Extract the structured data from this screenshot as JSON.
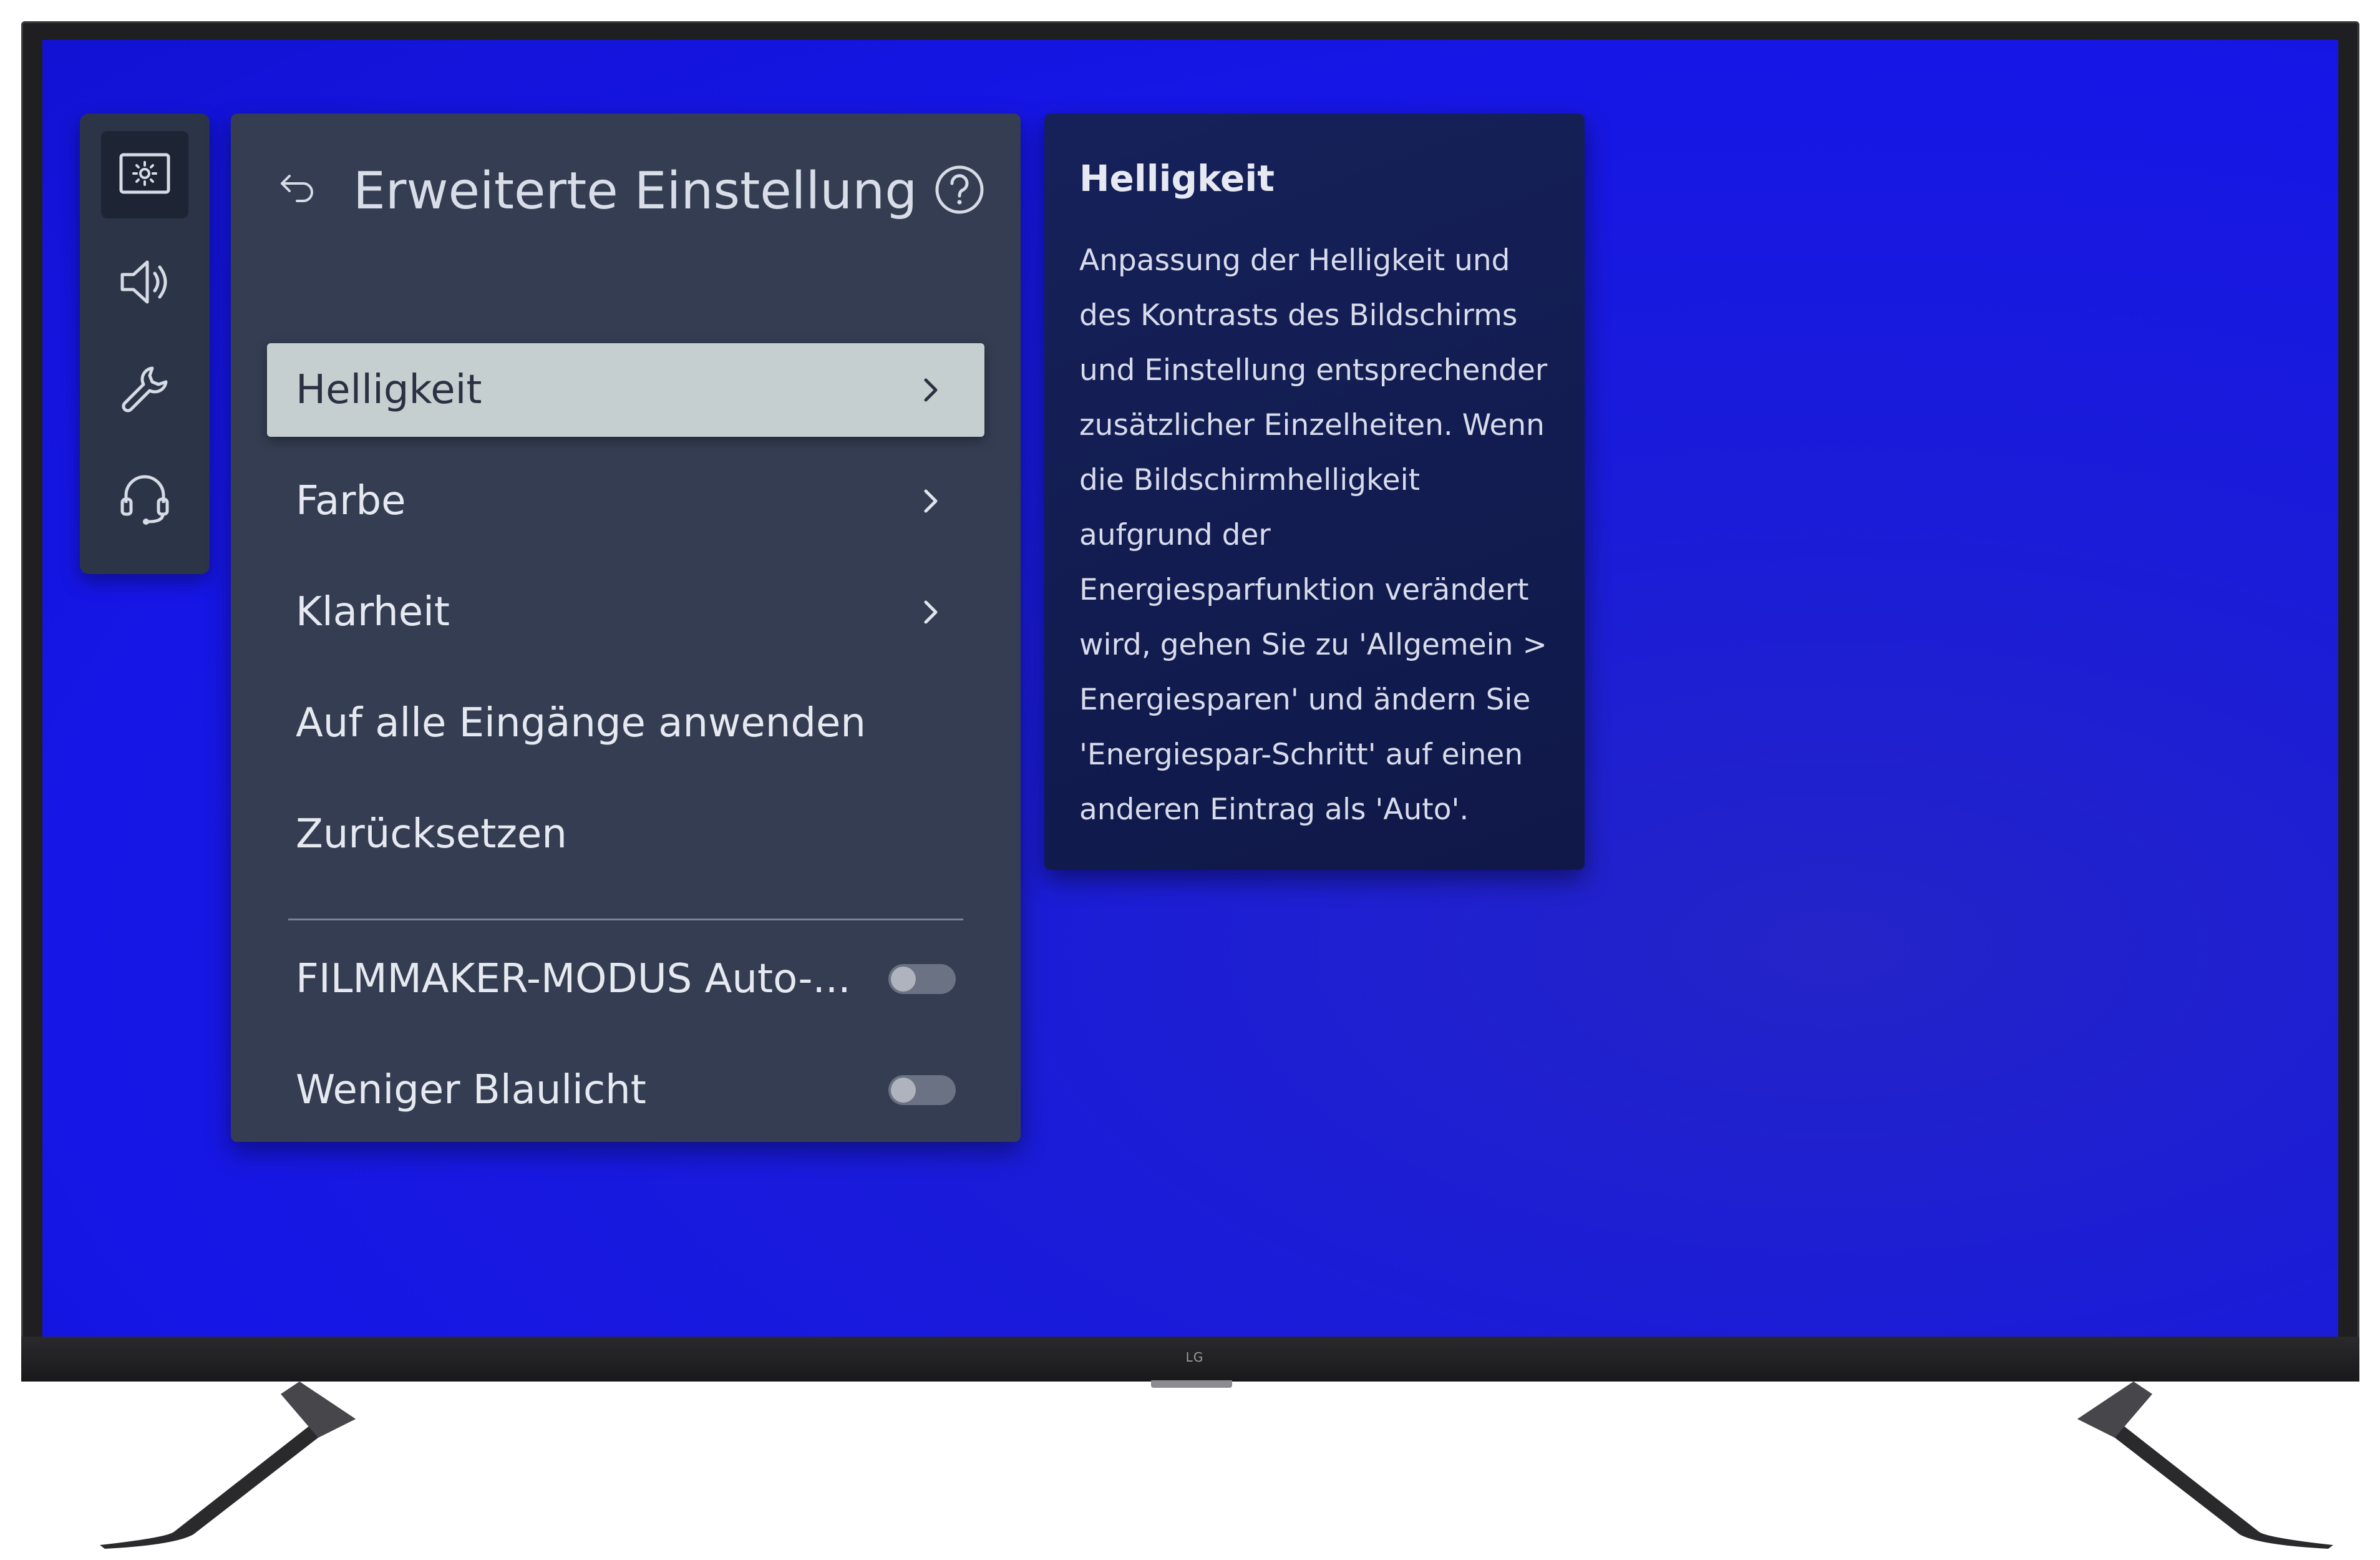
{
  "brand": "LG",
  "sidebar": {
    "items": [
      {
        "name": "picture",
        "icon": "picture-icon",
        "active": true
      },
      {
        "name": "sound",
        "icon": "speaker-icon",
        "active": false
      },
      {
        "name": "general",
        "icon": "wrench-icon",
        "active": false
      },
      {
        "name": "support",
        "icon": "headset-icon",
        "active": false
      }
    ]
  },
  "panel": {
    "title": "Erweiterte Einstellung",
    "back_icon": "back-arrow-icon",
    "help_icon": "question-icon"
  },
  "menu": {
    "items": [
      {
        "label": "Helligkeit",
        "selected": true,
        "has_submenu": true
      },
      {
        "label": "Farbe",
        "selected": false,
        "has_submenu": true
      },
      {
        "label": "Klarheit",
        "selected": false,
        "has_submenu": true
      },
      {
        "label": "Auf alle Eingänge anwenden",
        "selected": false,
        "has_submenu": false
      },
      {
        "label": "Zurücksetzen",
        "selected": false,
        "has_submenu": false
      }
    ],
    "toggles": [
      {
        "label": "FILMMAKER-MODUS Auto-...",
        "on": false
      },
      {
        "label": "Weniger Blaulicht",
        "on": false
      }
    ]
  },
  "help": {
    "title": "Helligkeit",
    "body": "Anpassung der Helligkeit und des Kontrasts des Bildschirms und Einstellung entsprechender zusätzlicher Einzelheiten. Wenn die Bildschirmhelligkeit aufgrund der Energiesparfunktion verändert wird, gehen Sie zu 'Allgemein > Energiesparen' und ändern Sie 'Energiespar-Schritt' auf einen anderen Eintrag als 'Auto'."
  },
  "colors": {
    "screen_background": "#1616e6",
    "panel_background": "#343d52",
    "selected_item": "#c6cfd0",
    "help_background": "#16215a"
  }
}
